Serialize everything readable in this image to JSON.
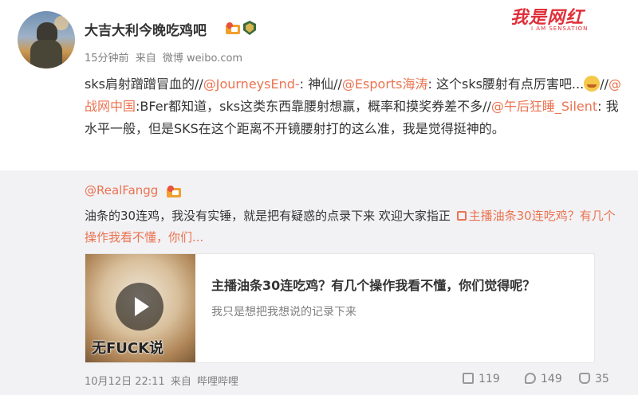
{
  "post": {
    "username": "大吉大利今晚吃鸡吧",
    "time": "15分钟前",
    "from_label": "来自",
    "source": "微博 weibo.com",
    "content": [
      {
        "t": "sks肩射蹭蹭冒血的//"
      },
      {
        "t": "@JourneysEnd-",
        "at": true
      },
      {
        "t": ": 神仙//"
      },
      {
        "t": "@Esports海涛",
        "at": true
      },
      {
        "t": ": 这个sks腰射有点厉害吧..."
      },
      {
        "emoji": "laugh-cry"
      },
      {
        "t": "//"
      },
      {
        "t": "@战网中国",
        "at": true
      },
      {
        "t": ":BFer都知道，sks这类东西靠腰射想赢，概率和摸奖券差不多//"
      },
      {
        "t": "@午后狂睡_Silent",
        "at": true
      },
      {
        "t": ": 我水平一般，但是SKS在这个距离不开镜腰射打的这么准，我是觉得挺神的。"
      }
    ]
  },
  "logo": {
    "text": "我是网红",
    "sub": "I AM SENSATION"
  },
  "repost": {
    "author": "@RealFangg",
    "text": "油条的30连鸡，我没有实锤，就是把有疑惑的点录下来 欢迎大家指正",
    "link_text": "主播油条30连吃鸡？有几个操作我看不懂，你们...",
    "card": {
      "title": "主播油条30连吃鸡？有几个操作我看不懂，你们觉得呢？",
      "desc": "我只是想把我想说的记录下来",
      "thumb_caption": "无FUCK说"
    },
    "date": "10月12日 22:11",
    "from_label": "来自",
    "source": "哔哩哔哩",
    "actions": {
      "repost": "119",
      "comment": "149",
      "like": "35"
    }
  },
  "colors": {
    "accent": "#eb7350",
    "repost_bg": "#f2f2f5",
    "logo": "#e0303a"
  }
}
